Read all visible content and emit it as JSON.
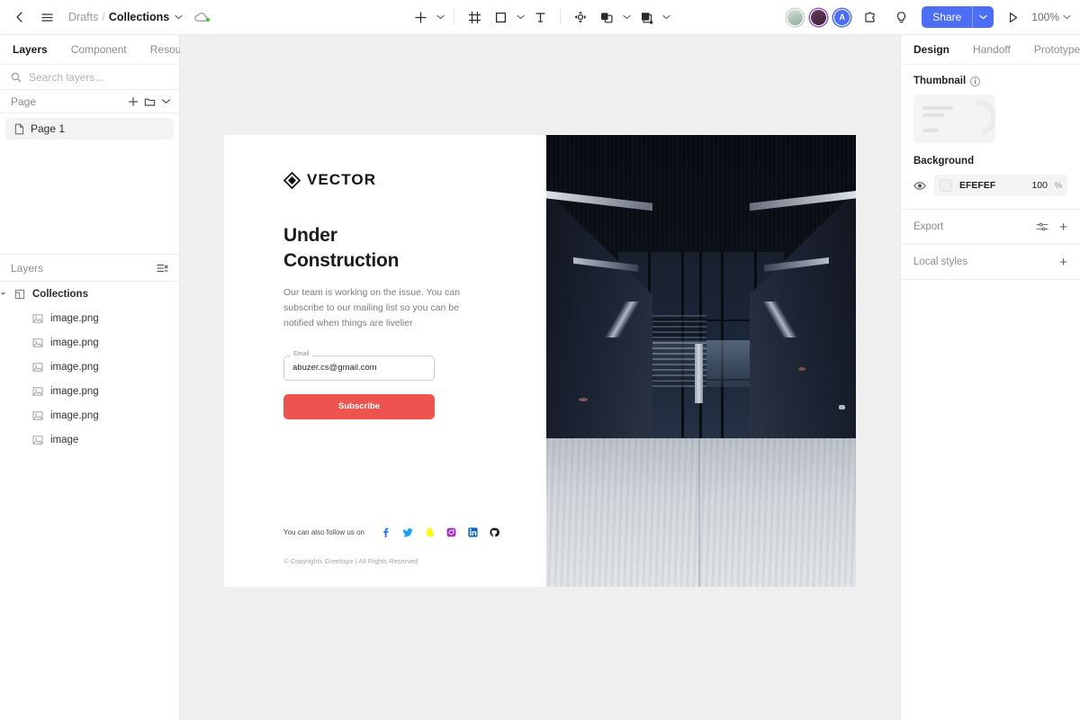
{
  "topbar": {
    "back_icon": "chevron-left-icon",
    "menu_icon": "hamburger-menu-icon",
    "breadcrumb": {
      "parent": "Drafts",
      "separator": "/",
      "current": "Collections"
    },
    "cloud_icon": "cloud-sync-icon",
    "tools": [
      {
        "name": "add-tool",
        "glyph": "plus",
        "caret": true
      },
      {
        "name": "frame-tool",
        "glyph": "frame",
        "caret": false
      },
      {
        "name": "shape-tool",
        "glyph": "square",
        "caret": true
      },
      {
        "name": "text-tool",
        "glyph": "text",
        "caret": false
      },
      {
        "name": "move-tool",
        "glyph": "move",
        "caret": false
      },
      {
        "name": "boolean-tool",
        "glyph": "boolean",
        "caret": true
      },
      {
        "name": "mask-tool",
        "glyph": "mask",
        "caret": true
      }
    ],
    "avatars": [
      {
        "name": "collaborator-avatar-1",
        "initial": ""
      },
      {
        "name": "collaborator-avatar-2",
        "initial": ""
      },
      {
        "name": "collaborator-avatar-3",
        "initial": "A"
      }
    ],
    "plugin_icon": "plugin-icon",
    "comment_icon": "comment-bulb-icon",
    "share_label": "Share",
    "present_icon": "play-present-icon",
    "zoom_level": "100%"
  },
  "left_panel": {
    "tabs": [
      {
        "label": "Layers",
        "active": true
      },
      {
        "label": "Component",
        "active": false
      },
      {
        "label": "Resource",
        "active": false
      }
    ],
    "search": {
      "placeholder": "Search layers...",
      "value": "",
      "icon": "search-icon"
    },
    "page_section": {
      "title": "Page",
      "add_icon": "plus-icon",
      "folder_icon": "folder-icon",
      "collapse_icon": "chevron-down-icon"
    },
    "pages": [
      {
        "label": "Page 1",
        "icon": "page-icon",
        "selected": true
      }
    ],
    "layers_section": {
      "title": "Layers",
      "collapse_all_icon": "collapse-all-icon"
    },
    "tree": [
      {
        "label": "Collections",
        "icon": "frame-icon",
        "depth": 0,
        "expanded": true
      },
      {
        "label": "image.png",
        "icon": "image-icon",
        "depth": 1
      },
      {
        "label": "image.png",
        "icon": "image-icon",
        "depth": 1
      },
      {
        "label": "image.png",
        "icon": "image-icon",
        "depth": 1
      },
      {
        "label": "image.png",
        "icon": "image-icon",
        "depth": 1
      },
      {
        "label": "image.png",
        "icon": "image-icon",
        "depth": 1
      },
      {
        "label": "image",
        "icon": "image-icon",
        "depth": 1
      }
    ]
  },
  "right_panel": {
    "tabs": [
      {
        "label": "Design",
        "active": true
      },
      {
        "label": "Handoff",
        "active": false
      },
      {
        "label": "Prototype",
        "active": false
      }
    ],
    "thumbnail": {
      "title": "Thumbnail",
      "info_icon": "info-icon",
      "info_glyph": "i"
    },
    "background": {
      "title": "Background",
      "visibility_icon": "eye-icon",
      "hex": "EFEFEF",
      "opacity": "100",
      "unit": "%"
    },
    "export": {
      "title": "Export",
      "settings_icon": "sliders-icon",
      "add_icon": "plus-icon",
      "add_glyph": "+"
    },
    "local_styles": {
      "title": "Local styles",
      "add_icon": "plus-icon",
      "add_glyph": "+"
    }
  },
  "canvas": {
    "background_color": "#EFEFEF",
    "artboard": {
      "logo": {
        "text": "VECTOR",
        "icon": "diamond-logo-icon"
      },
      "heading": "Under Construction",
      "subtext": "Our team is working on the issue. You can subscribe to our mailing list so you can be notified when things are livelier",
      "email_field": {
        "label": "Email",
        "value": "abuzer.cs@gmail.com",
        "placeholder": "Email"
      },
      "subscribe_button": {
        "label": "Subscribe",
        "color": "#EF5350"
      },
      "social": {
        "label": "You can also follow us on",
        "icons": [
          {
            "name": "facebook-icon",
            "color": "#1877F2"
          },
          {
            "name": "twitter-icon",
            "color": "#1DA1F2"
          },
          {
            "name": "snapchat-icon",
            "color": "#FFFC00"
          },
          {
            "name": "instagram-icon",
            "color": "#A32CC4"
          },
          {
            "name": "linkedin-icon",
            "color": "#0A66C2"
          },
          {
            "name": "github-icon",
            "color": "#181717"
          }
        ]
      },
      "copyright": "© Copyrights Greelogix | All Rights Reserved",
      "photo_alt": "dark-architecture-corridor-photo"
    }
  }
}
